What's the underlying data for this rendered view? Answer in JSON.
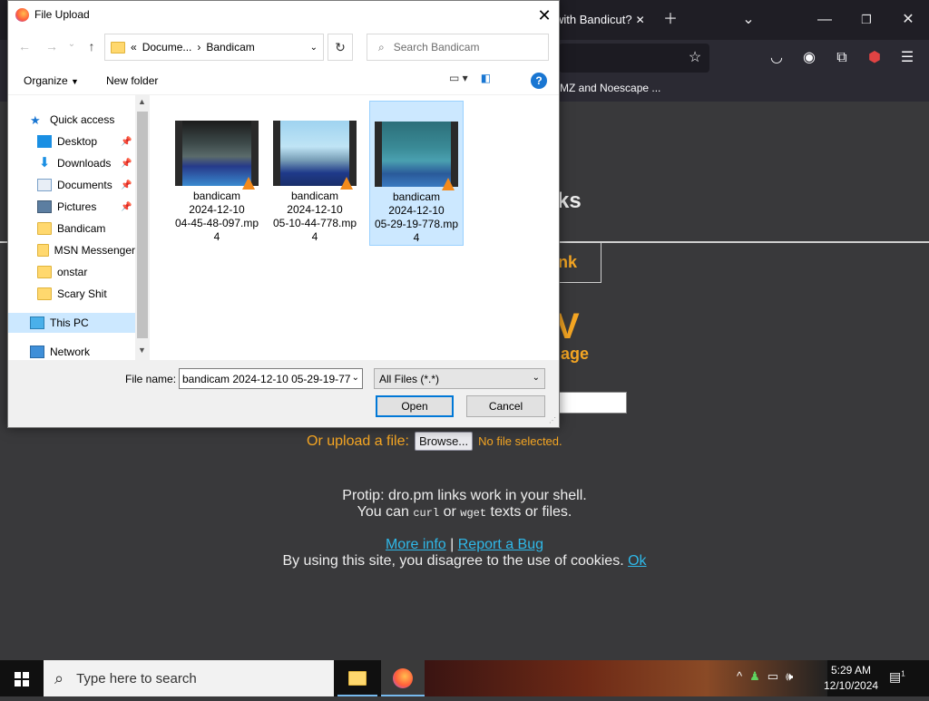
{
  "browser": {
    "tab_title": "with Bandicut?",
    "bookmark_label": "MZ and Noescape ...",
    "window_controls": [
      "minimize-icon",
      "maximize-icon",
      "close-icon"
    ]
  },
  "page": {
    "heading_fragment": "ks",
    "link_fragment": "nk",
    "big_letter": "V",
    "subtitle_fragment": "age",
    "upload_label": "Or upload a file:",
    "browse_label": "Browse...",
    "no_file": "No file selected.",
    "protip_line1": "Protip: dro.pm links work in your shell.",
    "protip_line2_a": "You can",
    "protip_code1": "curl",
    "protip_line2_b": "or",
    "protip_code2": "wget",
    "protip_line2_c": "texts or files.",
    "more_info": "More info",
    "separator": "|",
    "report_bug": "Report a Bug",
    "cookie_text": "By using this site, you disagree to the use of cookies.",
    "cookie_ok": "Ok"
  },
  "dialog": {
    "title": "File Upload",
    "breadcrumb": [
      "Docume...",
      "Bandicam"
    ],
    "breadcrumb_prefix": "«",
    "search_placeholder": "Search Bandicam",
    "organize_label": "Organize",
    "new_folder_label": "New folder",
    "nav": [
      {
        "label": "Quick access",
        "icon": "star-icon"
      },
      {
        "label": "Desktop",
        "icon": "desktop-icon",
        "pinned": true
      },
      {
        "label": "Downloads",
        "icon": "download-icon",
        "pinned": true
      },
      {
        "label": "Documents",
        "icon": "document-icon",
        "pinned": true
      },
      {
        "label": "Pictures",
        "icon": "pictures-icon",
        "pinned": true
      },
      {
        "label": "Bandicam",
        "icon": "folder-icon"
      },
      {
        "label": "MSN Messenger",
        "icon": "folder-icon"
      },
      {
        "label": "onstar",
        "icon": "folder-icon"
      },
      {
        "label": "Scary Shit",
        "icon": "folder-icon"
      },
      {
        "label": "This PC",
        "icon": "computer-icon"
      },
      {
        "label": "Network",
        "icon": "network-icon"
      }
    ],
    "files": [
      {
        "line1": "bandicam",
        "line2": "2024-12-10",
        "line3": "04-45-48-097.mp",
        "line4": "4"
      },
      {
        "line1": "bandicam",
        "line2": "2024-12-10",
        "line3": "05-10-44-778.mp",
        "line4": "4"
      },
      {
        "line1": "bandicam",
        "line2": "2024-12-10",
        "line3": "05-29-19-778.mp",
        "line4": "4"
      }
    ],
    "filename_label": "File name:",
    "filename_value": "bandicam 2024-12-10 05-29-19-77",
    "filter_value": "All Files (*.*)",
    "open_label": "Open",
    "cancel_label": "Cancel"
  },
  "taskbar": {
    "search_placeholder": "Type here to search",
    "time": "5:29 AM",
    "date": "12/10/2024",
    "notification_count": "1"
  }
}
